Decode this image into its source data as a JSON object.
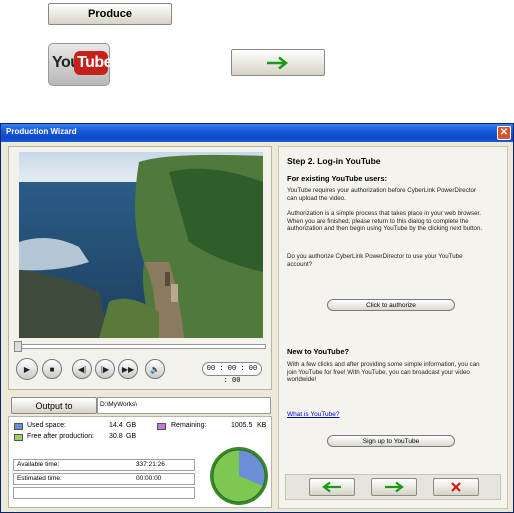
{
  "top": {
    "produce_label": "Produce",
    "youtube_logo": {
      "you": "You",
      "tube": "Tube"
    },
    "next_icon": "right-arrow-icon"
  },
  "window": {
    "title": "Production Wizard",
    "close_icon": "close-icon"
  },
  "player": {
    "timecode": "00 : 00 : 00 : 00",
    "seek_progress": 0.0
  },
  "output": {
    "label": "Output to",
    "path": "D:\\MyWorks\\"
  },
  "stats": {
    "used_label": "Used space:",
    "used_value": "14.4",
    "used_unit": "GB",
    "free_label": "Free after production:",
    "free_value": "30.8",
    "free_unit": "GB",
    "remaining_label": "Remaining:",
    "remaining_value": "1005.5",
    "remaining_unit": "KB",
    "available_label": "Available time:",
    "available_value": "337:21:26",
    "estimated_label": "Estimated time:",
    "estimated_value": "00:00:00",
    "colors": {
      "used": "#6a8fd6",
      "free": "#9ad162",
      "remaining": "#c07ad6"
    }
  },
  "right": {
    "step_title": "Step 2. Log-in YouTube",
    "existing_heading": "For existing YouTube users:",
    "existing_p1": "YouTube requires your authorization before CyberLink PowerDirector can upload the video.",
    "existing_p2": "Authorization is a simple process that takes place in your web browser. When you are finished, please return to this dialog to complete the authorization and then begin using YouTube by the clicking next button.",
    "existing_p3": "Do you authorize CyberLink PowerDirector to use your YouTube account?",
    "authorize_button": "Click to authorize",
    "new_heading": "New to YouTube?",
    "new_p1": "With a few clicks and after providing some simple information, you can join YouTube for free! With YouTube, you can broadcast your video worldwide!",
    "what_is_link": "What is YouTube?",
    "signup_button": "Sign up to YouTube"
  },
  "nav": {
    "back_icon": "left-arrow-icon",
    "next_icon": "right-arrow-icon",
    "cancel_icon": "x-icon"
  }
}
